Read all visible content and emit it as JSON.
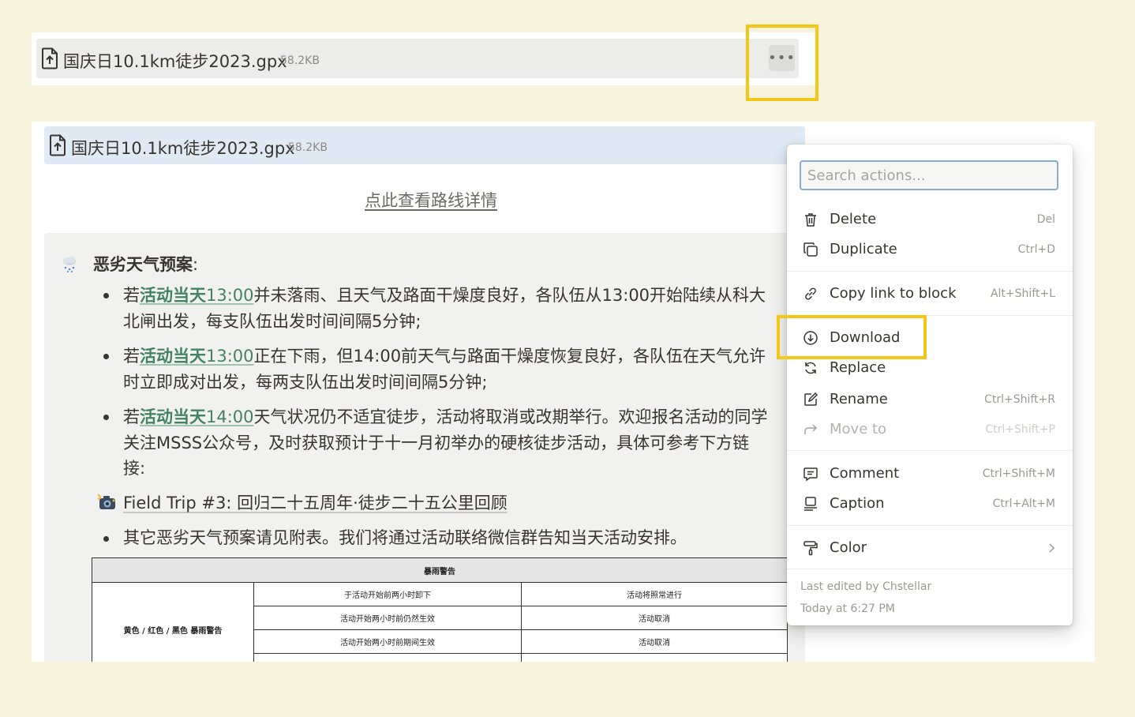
{
  "top_block": {
    "file_name": "国庆日10.1km徒步2023.gpx",
    "file_size": "58.2KB",
    "more_button": "•••"
  },
  "file_block": {
    "file_name": "国庆日10.1km徒步2023.gpx",
    "file_size": "58.2KB"
  },
  "route_link": "点此查看路线详情",
  "callout": {
    "heading": "恶劣天气预案",
    "heading_colon": ":",
    "bullets": [
      {
        "prefix": "若",
        "highlight_text": "活动当天",
        "highlight_time": "13:00",
        "line1": "并未落雨、且天气及路面干燥度良好，各队伍从13:00开始陆续从科大",
        "line2": "北闸出发，每支队伍出发时间间隔5分钟;"
      },
      {
        "prefix": "若",
        "highlight_text": "活动当天",
        "highlight_time": "13:00",
        "line1": "正在下雨，但14:00前天气与路面干燥度恢复良好，各队伍在天气允许",
        "line2": "时立即成对出发，每两支队伍出发时间间隔5分钟;"
      },
      {
        "prefix": "若",
        "highlight_text": "活动当天",
        "highlight_time": "14:00",
        "line1": "天气状况仍不适宜徒步，活动将取消或改期举行。欢迎报名活动的同学",
        "line2": "关注MSSS公众号，及时获取预计于十一月初举办的硬核徒步活动，具体可参考下方链",
        "line3": "接:"
      }
    ],
    "page_link": "Field Trip #3: 回归二十五周年·徒步二十五公里回顾",
    "last_bullet": "其它恶劣天气预案请见附表。我们将通过活动联络微信群告知当天活动安排。"
  },
  "table": {
    "header": "暴雨警告",
    "row_label": "黄色 / 红色 / 黑色 暴雨警告",
    "rows": [
      [
        "于活动开始前两小时卸下",
        "活动将照常进行"
      ],
      [
        "活动开始两小时前仍然生效",
        "活动取消"
      ],
      [
        "活动开始两小时前期间生效",
        "活动取消"
      ]
    ]
  },
  "menu": {
    "search_placeholder": "Search actions...",
    "items": [
      {
        "label": "Delete",
        "shortcut": "Del",
        "icon": "trash-icon"
      },
      {
        "label": "Duplicate",
        "shortcut": "Ctrl+D",
        "icon": "duplicate-icon"
      },
      {
        "label": "Copy link to block",
        "shortcut": "Alt+Shift+L",
        "icon": "link-icon"
      },
      {
        "label": "Download",
        "shortcut": "",
        "icon": "download-icon"
      },
      {
        "label": "Replace",
        "shortcut": "",
        "icon": "replace-icon"
      },
      {
        "label": "Rename",
        "shortcut": "Ctrl+Shift+R",
        "icon": "rename-icon"
      },
      {
        "label": "Move to",
        "shortcut": "Ctrl+Shift+P",
        "icon": "move-arrow-icon"
      },
      {
        "label": "Comment",
        "shortcut": "Ctrl+Shift+M",
        "icon": "comment-icon"
      },
      {
        "label": "Caption",
        "shortcut": "Ctrl+Alt+M",
        "icon": "caption-icon"
      },
      {
        "label": "Color",
        "shortcut": "",
        "icon": "paint-roller-icon"
      }
    ],
    "last_edited_by": "Last edited by Chstellar",
    "last_edited_time": "Today at 6:27 PM"
  },
  "colors": {
    "page_background": "#f8f3dd",
    "highlight_frame": "#f5c518",
    "link_green": "#448361",
    "file_block_blue": "#dfeaf5"
  }
}
